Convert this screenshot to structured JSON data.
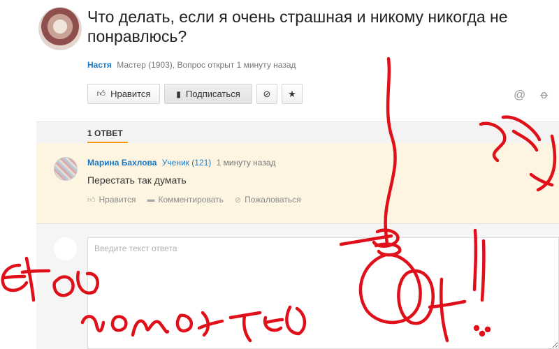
{
  "question": {
    "title": "Что делать, если я очень страшная и никому никогда не понравлюсь?",
    "author": "Настя",
    "meta": "Мастер (1903), Вопрос открыт 1 минуту назад"
  },
  "actions": {
    "like_label": "Нравится",
    "subscribe_label": "Подписаться"
  },
  "icons": {
    "like": "thumbs-up-icon",
    "subscribe": "bookmark-icon",
    "block": "block-icon",
    "star": "star-icon",
    "share_email": "at-icon",
    "share_ok": "ok-icon"
  },
  "answers": {
    "count_label": "1 ОТВЕТ",
    "items": [
      {
        "name": "Марина Бахлова",
        "rank": "Ученик (121)",
        "time": "1 минуту назад",
        "text": "Перестать так думать",
        "actions": [
          "Нравится",
          "Комментировать",
          "Пожаловаться"
        ]
      }
    ]
  },
  "reply": {
    "placeholder": "Введите текст ответа"
  },
  "colors": {
    "accent": "#f59a14",
    "link": "#1b78c4",
    "scribble": "#e0101a"
  }
}
